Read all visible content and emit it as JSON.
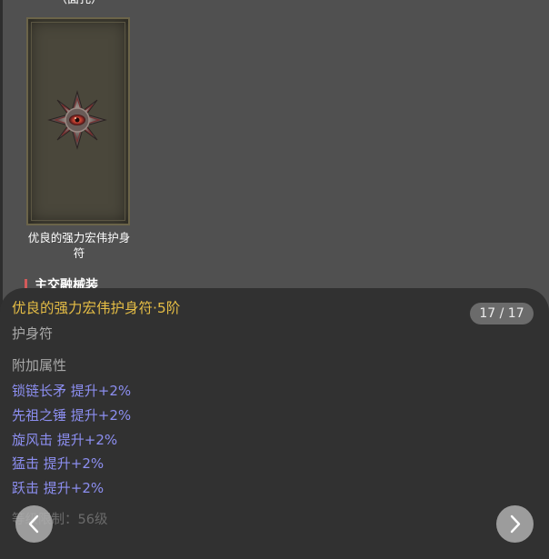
{
  "gallery": {
    "top_caption": "（面孔）",
    "item_name": "优良的强力宏伟护身符",
    "section_heading": "主交融械装"
  },
  "detail": {
    "title": "优良的强力宏伟护身符·5阶",
    "page_indicator": "17 / 17",
    "item_type": "护身符",
    "attributes_heading": "附加属性",
    "attributes": [
      "锁链长矛 提升+2%",
      "先祖之锤 提升+2%",
      "旋风击 提升+2%",
      "猛击 提升+2%",
      "跃击 提升+2%"
    ],
    "requirement": "等级限制：56级"
  },
  "icons": {
    "amulet": "amulet-icon",
    "prev": "chevron-left-icon",
    "next": "chevron-right-icon"
  },
  "colors": {
    "title": "#e5bd45",
    "attribute": "#8c8ef0",
    "panel_bg": "#313131",
    "page_bg": "#505050"
  }
}
